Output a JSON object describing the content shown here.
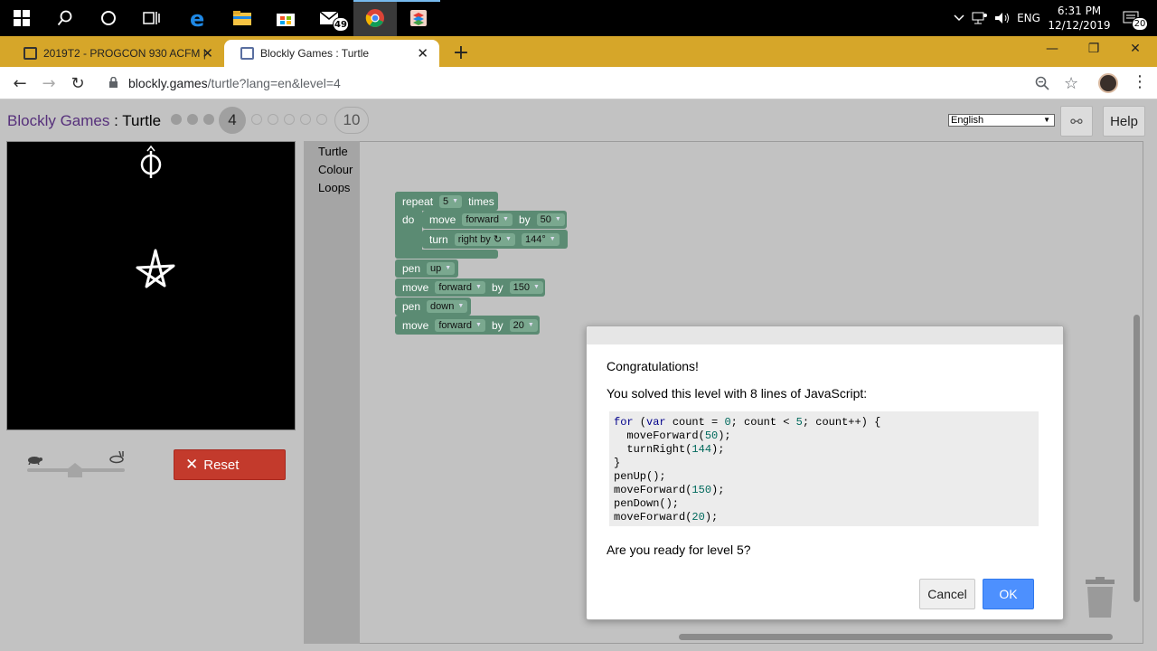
{
  "taskbar": {
    "mail_badge": "49",
    "lang": "ENG",
    "time": "6:31 PM",
    "date": "12/12/2019",
    "notif_badge": "20"
  },
  "browser": {
    "tabs": [
      {
        "label": "2019T2 - PROGCON 930 ACFM |"
      },
      {
        "label": "Blockly Games : Turtle"
      }
    ],
    "url_domain": "blockly.games",
    "url_rest": "/turtle?lang=en&level=4"
  },
  "page": {
    "title_link": "Blockly Games",
    "title_sep": " : ",
    "title_game": "Turtle",
    "current_level": "4",
    "last_level": "10",
    "language": "English",
    "help": "Help",
    "reset": "Reset"
  },
  "toolbox": {
    "categories": [
      "Turtle",
      "Colour",
      "Loops"
    ]
  },
  "blocks": {
    "repeat": "repeat",
    "repeat_count": "5",
    "times": "times",
    "do": "do",
    "move": "move",
    "forward": "forward",
    "by": "by",
    "dist1": "50",
    "turn": "turn",
    "right_by": "right by ↻",
    "angle": "144°",
    "pen": "pen",
    "up": "up",
    "dist2": "150",
    "down": "down",
    "dist3": "20"
  },
  "dialog": {
    "congrats": "Congratulations!",
    "solved": "You solved this level with 8 lines of JavaScript:",
    "code": [
      "for (var count = 0; count < 5; count++) {",
      "  moveForward(50);",
      "  turnRight(144);",
      "}",
      "penUp();",
      "moveForward(150);",
      "penDown();",
      "moveForward(20);"
    ],
    "ready": "Are you ready for level 5?",
    "cancel": "Cancel",
    "ok": "OK"
  },
  "colors": {
    "tabbar": "#d6a629",
    "block": "#5b8b73",
    "reset": "#c33a2c",
    "ok": "#4d90fe",
    "title_link": "#56307b"
  }
}
